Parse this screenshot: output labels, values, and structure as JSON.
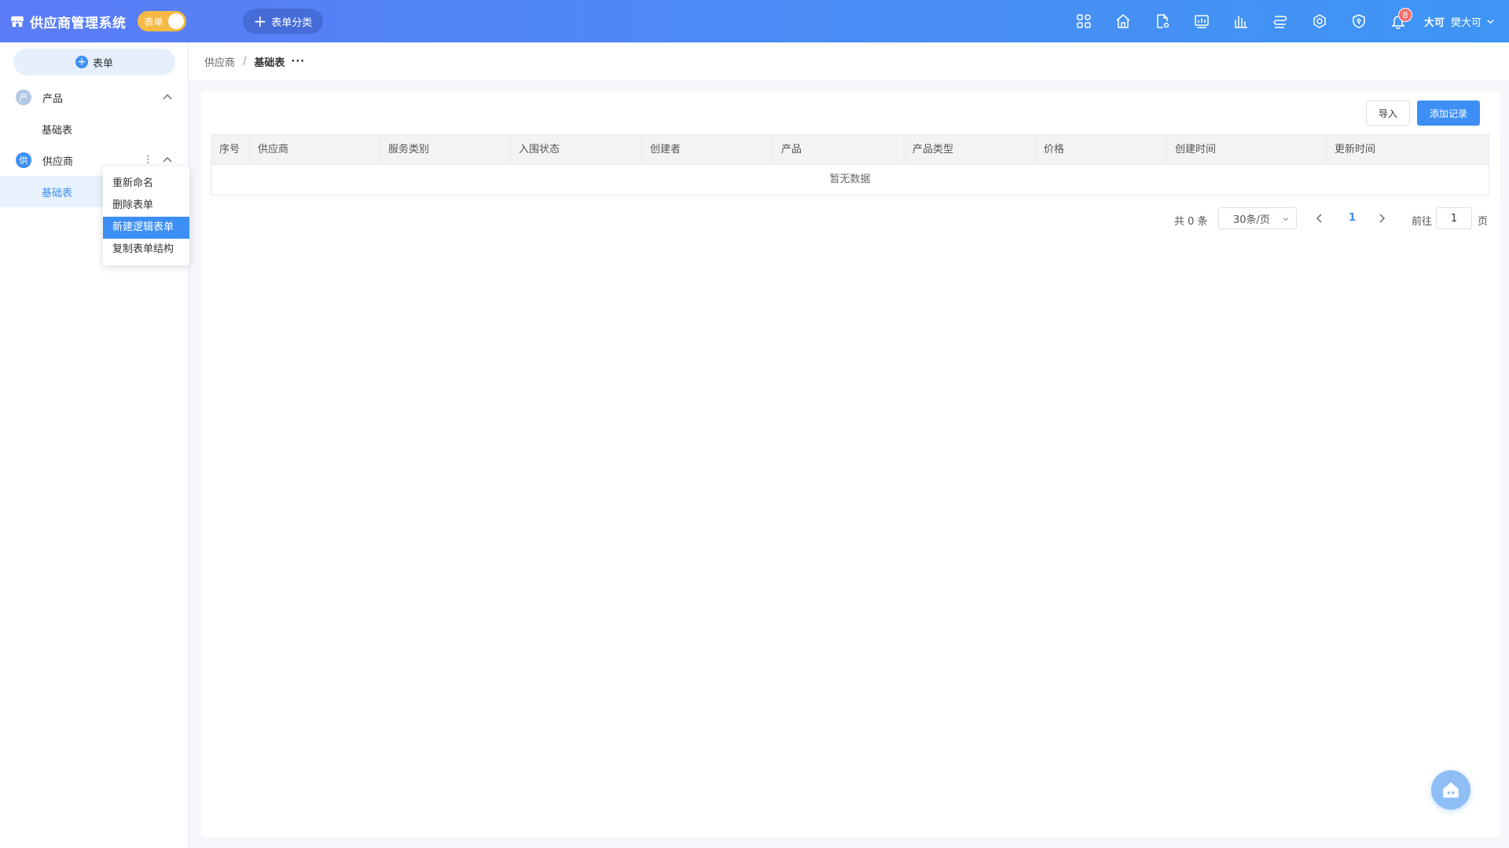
{
  "header": {
    "app_title": "供应商管理系统",
    "mode_toggle_label": "表单",
    "category_button_label": "表单分类",
    "notification_count": "8",
    "avatar_text": "大可",
    "user_name": "樊大可",
    "accent_color": "#3d8ff5",
    "toggle_color": "#f5b944"
  },
  "sidebar": {
    "add_form_label": "表单",
    "groups": [
      {
        "badge": "产",
        "badge_color": "#b4c7e7",
        "label": "产品",
        "items": [
          {
            "label": "基础表"
          }
        ]
      },
      {
        "badge": "供",
        "badge_color": "#3d8ff5",
        "label": "供应商",
        "items": [
          {
            "label": "基础表"
          }
        ]
      }
    ],
    "context_menu": [
      "重新命名",
      "删除表单",
      "新建逻辑表单",
      "复制表单结构"
    ]
  },
  "breadcrumb": {
    "parent": "供应商",
    "separator": "/",
    "current": "基础表",
    "more": "···"
  },
  "toolbar": {
    "import_label": "导入",
    "add_record_label": "添加记录"
  },
  "table": {
    "columns": [
      "序号",
      "供应商",
      "服务类别",
      "入围状态",
      "创建者",
      "产品",
      "产品类型",
      "价格",
      "创建时间",
      "更新时间"
    ],
    "empty_text": "暂无数据"
  },
  "pagination": {
    "total_text": "共 0 条",
    "page_size": "30条/页",
    "current_page": "1",
    "goto_prefix": "前往",
    "goto_value": "1",
    "goto_suffix": "页"
  }
}
